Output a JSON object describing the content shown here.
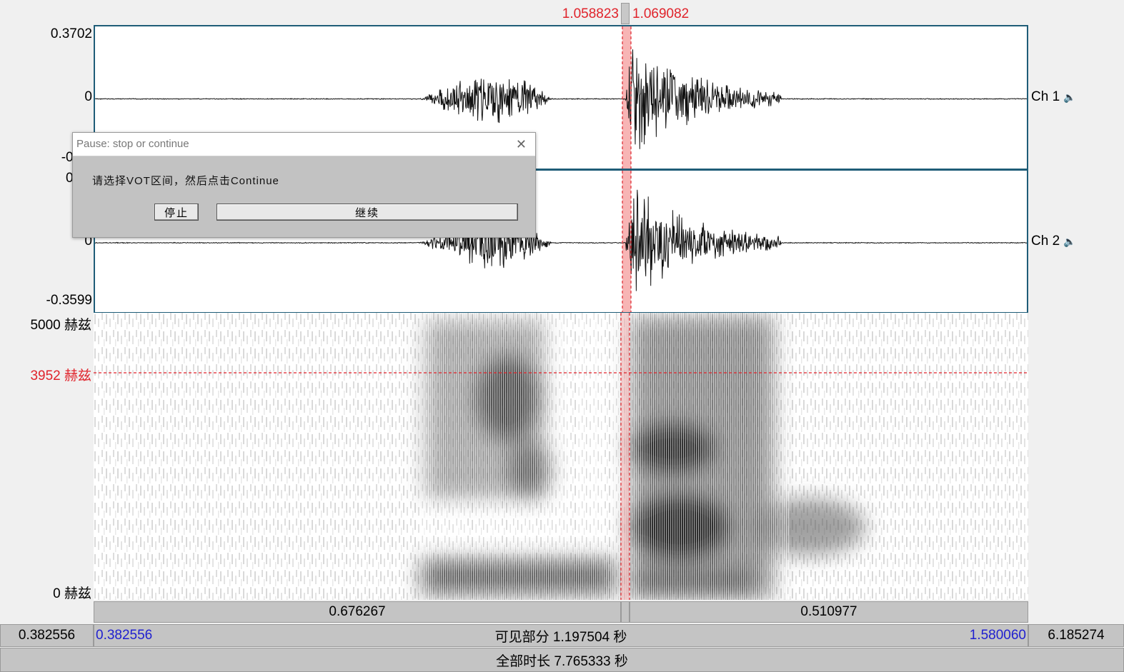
{
  "selection": {
    "start_label": "1.058823",
    "end_label": "1.069082"
  },
  "channel1": {
    "label": "Ch 1",
    "y_max": "0.3702",
    "y_zero": "0",
    "y_min": "-0.35"
  },
  "channel2": {
    "label": "Ch 2",
    "y_max": "0.37",
    "y_zero": "0",
    "y_min": "-0.3599"
  },
  "spectrogram": {
    "f_max": "5000 赫兹",
    "f_cursor": "3952 赫兹",
    "f_min": "0 赫兹"
  },
  "segments": {
    "left_duration": "0.676267",
    "right_duration": "0.510977"
  },
  "window_bar": {
    "outer_start": "0.382556",
    "visible_start": "0.382556",
    "visible_label": "可见部分 1.197504 秒",
    "visible_end": "1.580060",
    "outer_end": "6.185274"
  },
  "total_bar": {
    "label": "全部时长 7.765333 秒"
  },
  "dialog": {
    "title": "Pause: stop or continue",
    "message": "请选择VOT区间，然后点击Continue",
    "stop_label": "停止",
    "continue_label": "继续"
  },
  "colors": {
    "selection": "#f7b5b5",
    "cursor": "#e0232b",
    "panel_border": "#1f5d78"
  }
}
